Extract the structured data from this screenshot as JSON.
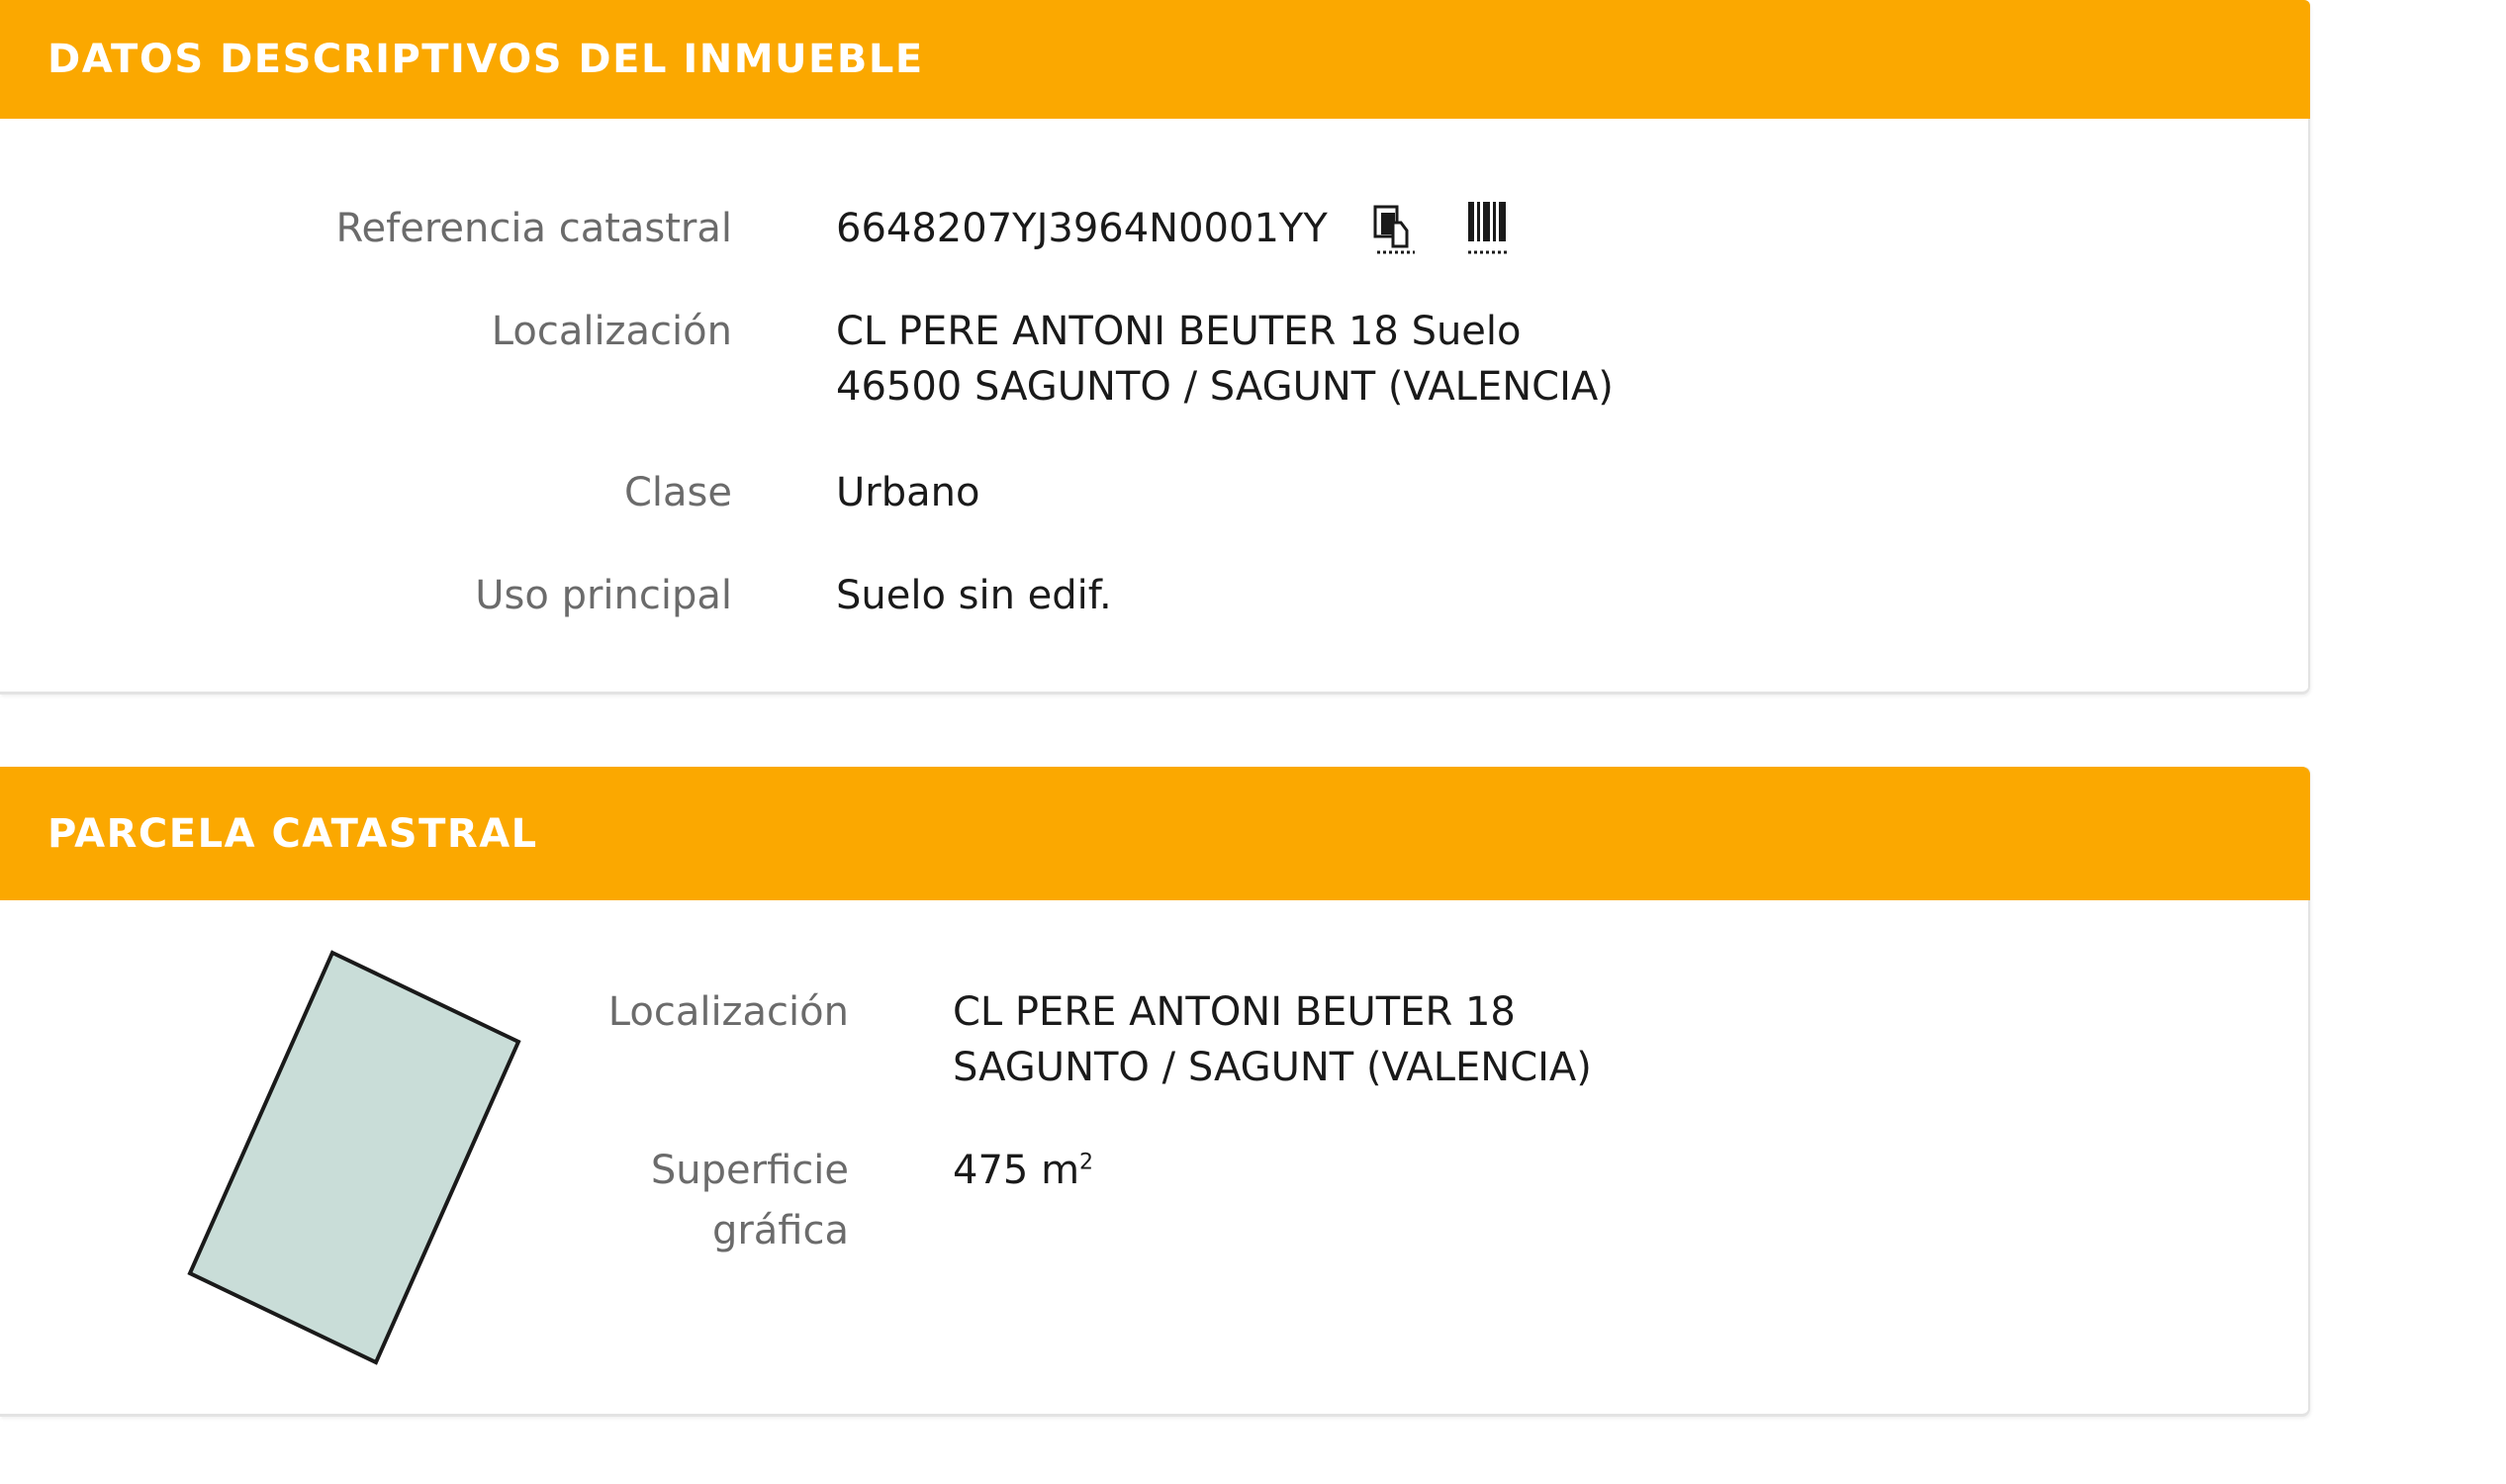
{
  "descriptive": {
    "title": "DATOS DESCRIPTIVOS DEL INMUEBLE",
    "fields": {
      "ref_label": "Referencia catastral",
      "ref_value": "6648207YJ3964N0001YY",
      "loc_label": "Localización",
      "loc_line1": "CL PERE ANTONI BEUTER 18 Suelo",
      "loc_line2": "46500 SAGUNTO / SAGUNT (VALENCIA)",
      "clase_label": "Clase",
      "clase_value": "Urbano",
      "uso_label": "Uso principal",
      "uso_value": "Suelo sin edif."
    },
    "icons": [
      "copy-icon",
      "barcode-icon"
    ]
  },
  "parcela": {
    "title": "PARCELA CATASTRAL",
    "loc_label": "Localización",
    "loc_line1": "CL PERE ANTONI BEUTER 18",
    "loc_line2": "SAGUNTO / SAGUNT (VALENCIA)",
    "sup_label_line1": "Superficie",
    "sup_label_line2": "gráfica",
    "sup_value": "475 m",
    "sup_unit_exp": "2",
    "shape_fill": "#c9ddd8",
    "shape_stroke": "#1a1a1a"
  },
  "colors": {
    "header_bg": "#fba800",
    "header_text": "#ffffff",
    "label_text": "#6b6b6b",
    "value_text": "#1a1a1a"
  }
}
